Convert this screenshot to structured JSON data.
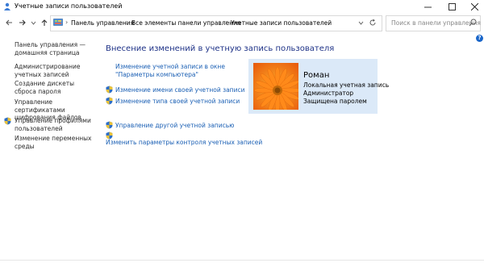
{
  "window": {
    "title": "Учетные записи пользователей",
    "minimize_icon": "minimize-icon",
    "maximize_icon": "maximize-icon",
    "close_icon": "close-icon"
  },
  "nav": {
    "back_icon": "back-arrow-icon",
    "forward_icon": "forward-arrow-icon",
    "recent_icon": "chevron-down-icon",
    "up_icon": "up-arrow-icon"
  },
  "address": {
    "crumbs": [
      "Панель управления",
      "Все элементы панели управления",
      "Учетные записи пользователей"
    ],
    "separator": "›"
  },
  "search": {
    "placeholder": "Поиск в панели управления"
  },
  "sidebar": {
    "items": [
      {
        "label": "Панель управления — домашняя страница",
        "shield": false
      },
      {
        "label": "Администрирование учетных записей",
        "shield": false
      },
      {
        "label": "Создание дискеты сброса пароля",
        "shield": false
      },
      {
        "label": "Управление сертификатами шифрования файлов",
        "shield": false
      },
      {
        "label": "Управление профилями пользователей",
        "shield": true
      },
      {
        "label": "Изменение переменных среды",
        "shield": false
      }
    ]
  },
  "main": {
    "heading": "Внесение изменений в учетную запись пользователя",
    "links": [
      {
        "label": "Изменение учетной записи в окне \"Параметры компьютера\"",
        "shield": false
      },
      {
        "label": "Изменение имени своей учетной записи",
        "shield": true
      },
      {
        "label": "Изменение типа своей учетной записи",
        "shield": true
      },
      {
        "label": "Управление другой учетной записью",
        "shield": true
      },
      {
        "label": "Изменить параметры контроля учетных записей",
        "shield": true
      }
    ]
  },
  "user": {
    "name": "Роман",
    "type": "Локальная учетная запись",
    "role": "Администратор",
    "protection": "Защищена паролем"
  },
  "colors": {
    "heading": "#1e3287",
    "link": "#1a5fb4",
    "card_bg": "#dbe9f8"
  }
}
